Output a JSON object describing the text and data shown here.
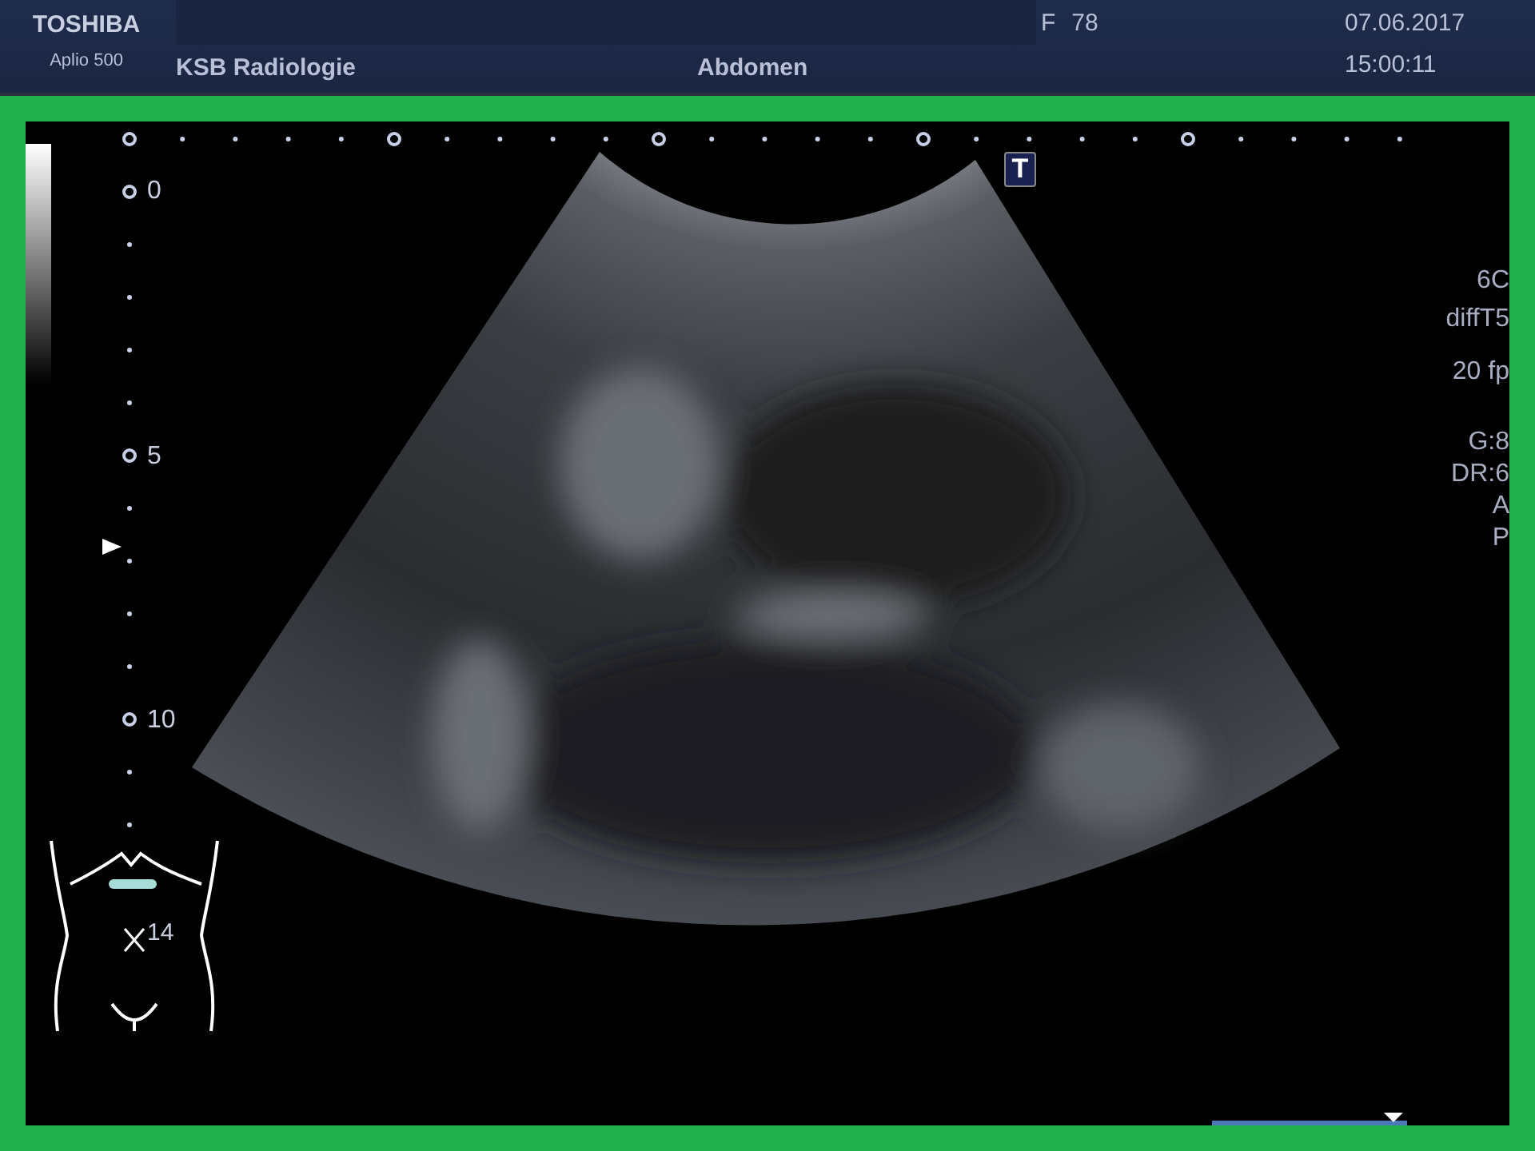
{
  "header": {
    "brand": "TOSHIBA",
    "model": "Aplio 500",
    "institution": "KSB Radiologie",
    "exam": "Abdomen",
    "sex": "F",
    "age": "78",
    "date": "07.06.2017",
    "time": "15:00:11"
  },
  "scan": {
    "tag": "T",
    "depth_labels": [
      "0",
      "5",
      "10"
    ],
    "params": [
      "6C",
      "diffT5",
      "20 fp",
      "G:8",
      "DR:6",
      "A",
      "P"
    ],
    "body_marker": {
      "label": "14"
    }
  },
  "cine_bar": {
    "level": 0.93
  }
}
